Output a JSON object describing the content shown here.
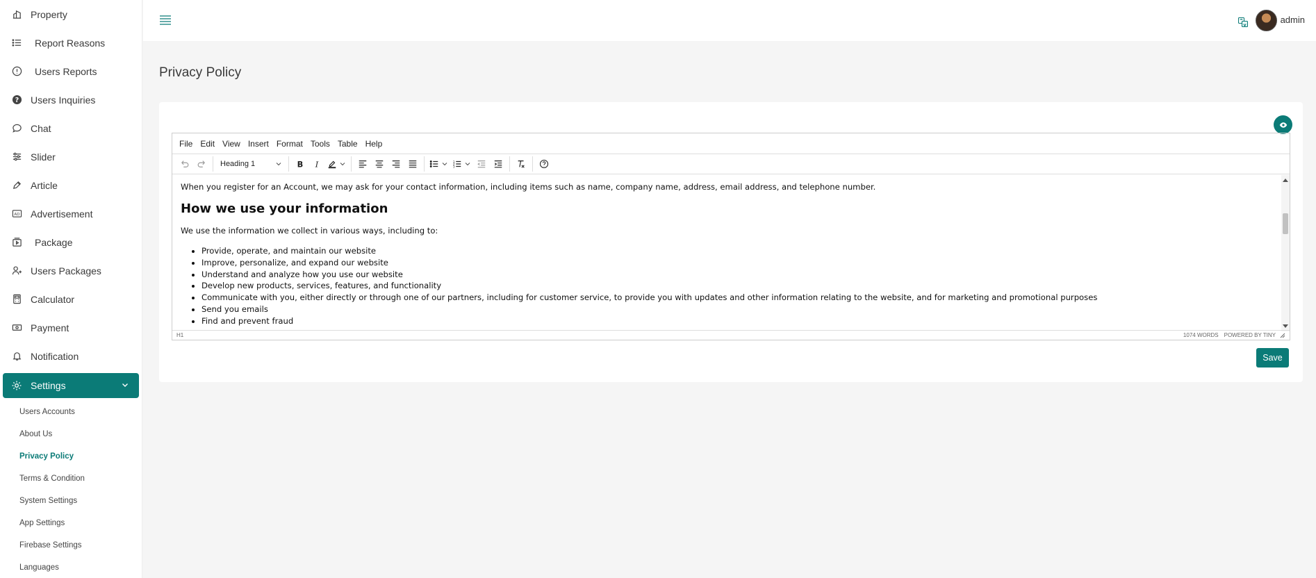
{
  "sidebar": {
    "items": [
      {
        "label": "Property",
        "icon": "building-icon"
      },
      {
        "label": "Report Reasons",
        "icon": "list-icon"
      },
      {
        "label": "Users Reports",
        "icon": "alert-circle-icon"
      },
      {
        "label": "Users Inquiries",
        "icon": "question-circle-icon"
      },
      {
        "label": "Chat",
        "icon": "chat-bubble-icon"
      },
      {
        "label": "Slider",
        "icon": "sliders-icon"
      },
      {
        "label": "Article",
        "icon": "pen-icon"
      },
      {
        "label": "Advertisement",
        "icon": "ad-icon"
      },
      {
        "label": "Package",
        "icon": "package-icon"
      },
      {
        "label": "Users Packages",
        "icon": "user-package-icon"
      },
      {
        "label": "Calculator",
        "icon": "calculator-icon"
      },
      {
        "label": "Payment",
        "icon": "payment-icon"
      },
      {
        "label": "Notification",
        "icon": "bell-icon"
      }
    ],
    "settings_label": "Settings",
    "sub_items": [
      "Users Accounts",
      "About Us",
      "Privacy Policy",
      "Terms & Condition",
      "System Settings",
      "App Settings",
      "Firebase Settings",
      "Languages"
    ],
    "active_sub_item": "Privacy Policy"
  },
  "topbar": {
    "username": "admin"
  },
  "page": {
    "title": "Privacy Policy"
  },
  "editor": {
    "menu": [
      "File",
      "Edit",
      "View",
      "Insert",
      "Format",
      "Tools",
      "Table",
      "Help"
    ],
    "block_format": "Heading 1",
    "content": {
      "intro": "When you register for an Account, we may ask for your contact information, including items such as name, company name, address, email address, and telephone number.",
      "heading": "How we use your information",
      "lead": "We use the information we collect in various ways, including to:",
      "list": [
        "Provide, operate, and maintain our website",
        "Improve, personalize, and expand our website",
        "Understand and analyze how you use our website",
        "Develop new products, services, features, and functionality",
        "Communicate with you, either directly or through one of our partners, including for customer service, to provide you with updates and other information relating to the website, and for marketing and promotional purposes",
        "Send you emails",
        "Find and prevent fraud"
      ]
    },
    "status_path": "H1",
    "word_count": "1074 WORDS",
    "powered_by": "POWERED BY TINY"
  },
  "actions": {
    "save_label": "Save"
  },
  "colors": {
    "accent": "#0b7b77",
    "background": "#f5f5f5"
  }
}
